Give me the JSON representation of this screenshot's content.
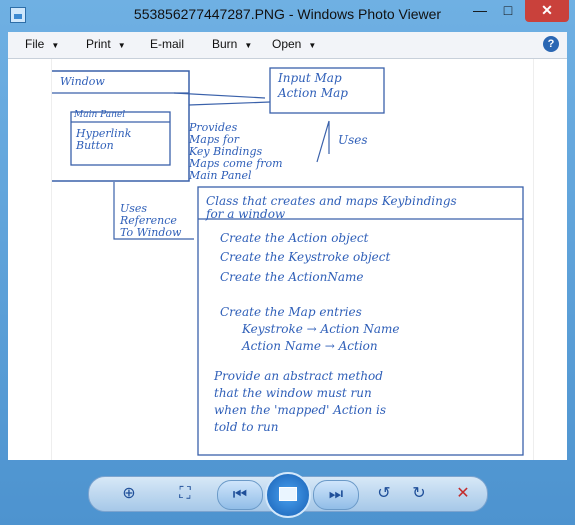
{
  "window": {
    "title": "553856277447287.PNG - Windows Photo Viewer"
  },
  "menu": {
    "file": "File",
    "print": "Print",
    "email": "E-mail",
    "burn": "Burn",
    "open": "Open",
    "help": "?"
  },
  "controls": {
    "min": "—",
    "max": "□",
    "close": "✕"
  },
  "drawing": {
    "window_label": "Window",
    "main_panel": "Main Panel",
    "hyperlink": "Hyperlink",
    "button": "Button",
    "input_map": "Input Map",
    "action_map": "Action Map",
    "uses_top": "Uses",
    "provides": [
      "Provides",
      "Maps for",
      "Key Bindings",
      "Maps come from",
      "Main Panel"
    ],
    "uses_ref": [
      "Uses",
      "Reference",
      "To Window"
    ],
    "class_title": [
      "Class that creates and maps Keybindings",
      "for a window"
    ],
    "steps": [
      "Create the Action object",
      "Create the Keystroke object",
      "Create the ActionName",
      "Create the Map entries",
      "Keystroke → Action Name",
      "Action Name → Action",
      "Provide an abstract method",
      "that the window must run",
      "when the 'mapped' Action is",
      "told to run"
    ]
  },
  "toolbar": {
    "zoom": "zoom-icon",
    "fit": "fit-icon",
    "prev": "previous-icon",
    "slideshow": "slideshow-icon",
    "next": "next-icon",
    "rotate_ccw": "rotate-left-icon",
    "rotate_cw": "rotate-right-icon",
    "delete": "delete-icon"
  }
}
